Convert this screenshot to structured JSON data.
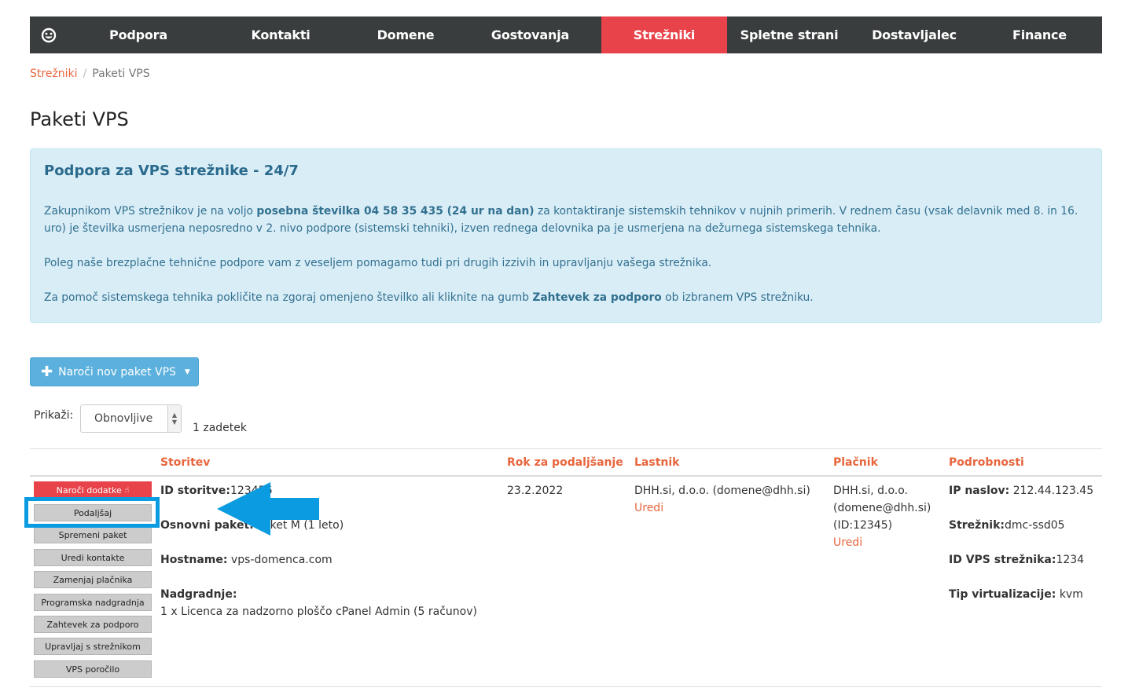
{
  "nav": {
    "home_icon": "smiley-icon",
    "items": [
      "Podpora",
      "Kontakti",
      "Domene",
      "Gostovanja",
      "Strežniki",
      "Spletne strani",
      "Dostavljalec",
      "Finance"
    ],
    "active_index": 4,
    "active_color": "#e8424a",
    "bg_color": "#3a3d3e"
  },
  "breadcrumb": {
    "parent": "Strežniki",
    "separator": "/",
    "current": "Paketi VPS"
  },
  "page_title": "Paketi VPS",
  "info": {
    "title": "Podpora za VPS strežnike - 24/7",
    "p1_a": "Zakupnikom VPS strežnikov je na voljo ",
    "p1_b": "posebna številka 04 58 35 435 (24 ur na dan)",
    "p1_c": " za kontaktiranje sistemskih tehnikov v nujnih primerih. V rednem času (vsak delavnik med 8. in 16. uro) je številka usmerjena neposredno v 2. nivo podpore (sistemski tehniki), izven rednega delovnika pa je usmerjena na dežurnega sistemskega tehnika.",
    "p2": "Poleg naše brezplačne tehnične podpore vam z veseljem pomagamo tudi pri drugih izzivih in upravljanju vašega strežnika.",
    "p3_a": "Za pomoč sistemskega tehnika pokličite na zgoraj omenjeno številko ali kliknite na gumb ",
    "p3_b": "Zahtevek za podporo",
    "p3_c": " ob izbranem VPS strežniku."
  },
  "order_button": {
    "label": "Naroči nov paket VPS",
    "icon": "plus-icon"
  },
  "filter": {
    "label": "Prikaži:",
    "selected": "Obnovljive",
    "count": "1 zadetek"
  },
  "table": {
    "headers": [
      "Storitev",
      "Rok za podaljšanje",
      "Lastnik",
      "Plačnik",
      "Podrobnosti"
    ],
    "row": {
      "actions": [
        "Naroči dodatke",
        "Podaljšaj",
        "Spremeni paket",
        "Uredi kontakte",
        "Zamenjaj plačnika",
        "Programska nadgradnja",
        "Zahtevek za podporo",
        "Upravljaj s strežnikom",
        "VPS poročilo"
      ],
      "service_id_label": "ID storitve:",
      "service_id": "123456",
      "package_label": "Osnovni paket:",
      "package": "Paket M (1 leto)",
      "hostname_label": "Hostname:",
      "hostname": "vps-domenca.com",
      "upgrades_label": "Nadgradnje:",
      "upgrades": "1 x Licenca za nadzorno ploščo cPanel Admin (5 računov)",
      "renewal": "23.2.2022",
      "owner": "DHH.si, d.o.o. (domene@dhh.si)",
      "owner_edit": "Uredi",
      "payer_line1": "DHH.si, d.o.o.",
      "payer_line2": "(domene@dhh.si)",
      "payer_line3": "(ID:12345)",
      "payer_edit": "Uredi",
      "ip_label": "IP naslov:",
      "ip": "212.44.123.45",
      "server_label": "Strežnik:",
      "server": "dmc-ssd05",
      "vps_id_label": "ID VPS strežnika:",
      "vps_id": "1234",
      "virt_label": "Tip virtualizacije:",
      "virt": "kvm"
    }
  },
  "annotation_color": "#0a9be0"
}
